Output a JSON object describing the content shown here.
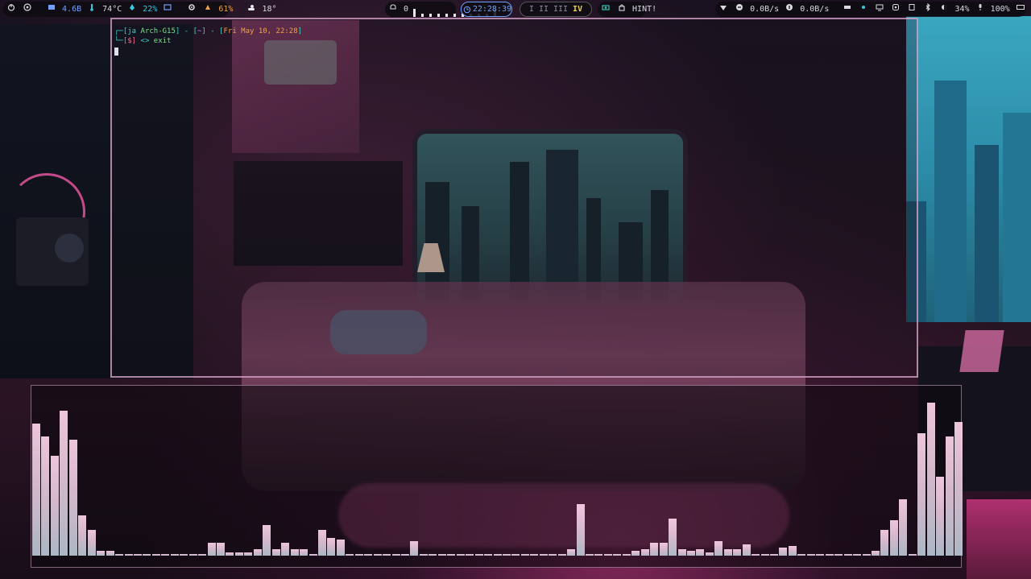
{
  "topbar": {
    "left": {
      "power_icon": "power-icon",
      "arch_icon": "arch-logo-icon",
      "memory": "4.6B",
      "temperature": "74°C",
      "cpu": "22%",
      "gpu_icon": "gpu-icon",
      "disk_icon": "gear-icon",
      "fan": "61%",
      "weather": "18°"
    },
    "media": {
      "notification": "0",
      "volume_icon": "bell-icon"
    },
    "clock": "22:28:39",
    "workspaces": [
      "I",
      "II",
      "III",
      "IV"
    ],
    "active_workspace": "IV",
    "hint": "HINT!",
    "right": {
      "net_down": "0.0B/s",
      "net_up": "0.0B/s",
      "brightness": "34%",
      "battery": "100%",
      "keyboard_layout": "us"
    },
    "colors": {
      "accent": "#35c8e0",
      "clock": "#6fa2ff",
      "workspace_active": "#e6cf4c"
    }
  },
  "terminal": {
    "prompt_user": "ja",
    "prompt_host": "Arch-G15",
    "prompt_dir": "~",
    "prompt_date": "Fri May 10, 22:28",
    "prompt_symbol": "[$]",
    "command": "exit",
    "border_color": "#e2aad2"
  },
  "visualizer": {
    "bar_color": "#e6c7dc",
    "levels": [
      0.82,
      0.74,
      0.62,
      0.9,
      0.72,
      0.25,
      0.16,
      0.03,
      0.03,
      0,
      0,
      0,
      0,
      0,
      0,
      0,
      0,
      0,
      0,
      0.08,
      0.08,
      0.02,
      0.02,
      0.02,
      0.04,
      0.19,
      0.04,
      0.08,
      0.04,
      0.04,
      0,
      0.16,
      0.11,
      0.1,
      0,
      0,
      0,
      0,
      0,
      0,
      0,
      0.09,
      0,
      0,
      0,
      0,
      0,
      0,
      0,
      0,
      0,
      0,
      0,
      0,
      0,
      0,
      0,
      0,
      0.04,
      0.32,
      0,
      0,
      0,
      0,
      0,
      0.03,
      0.04,
      0.08,
      0.08,
      0.23,
      0.04,
      0.03,
      0.04,
      0.02,
      0.09,
      0.04,
      0.04,
      0.07,
      0,
      0,
      0,
      0.05,
      0.06,
      0,
      0,
      0,
      0,
      0,
      0,
      0,
      0,
      0.03,
      0.16,
      0.22,
      0.35,
      0,
      0.76,
      0.95,
      0.49,
      0.74,
      0.83
    ]
  }
}
